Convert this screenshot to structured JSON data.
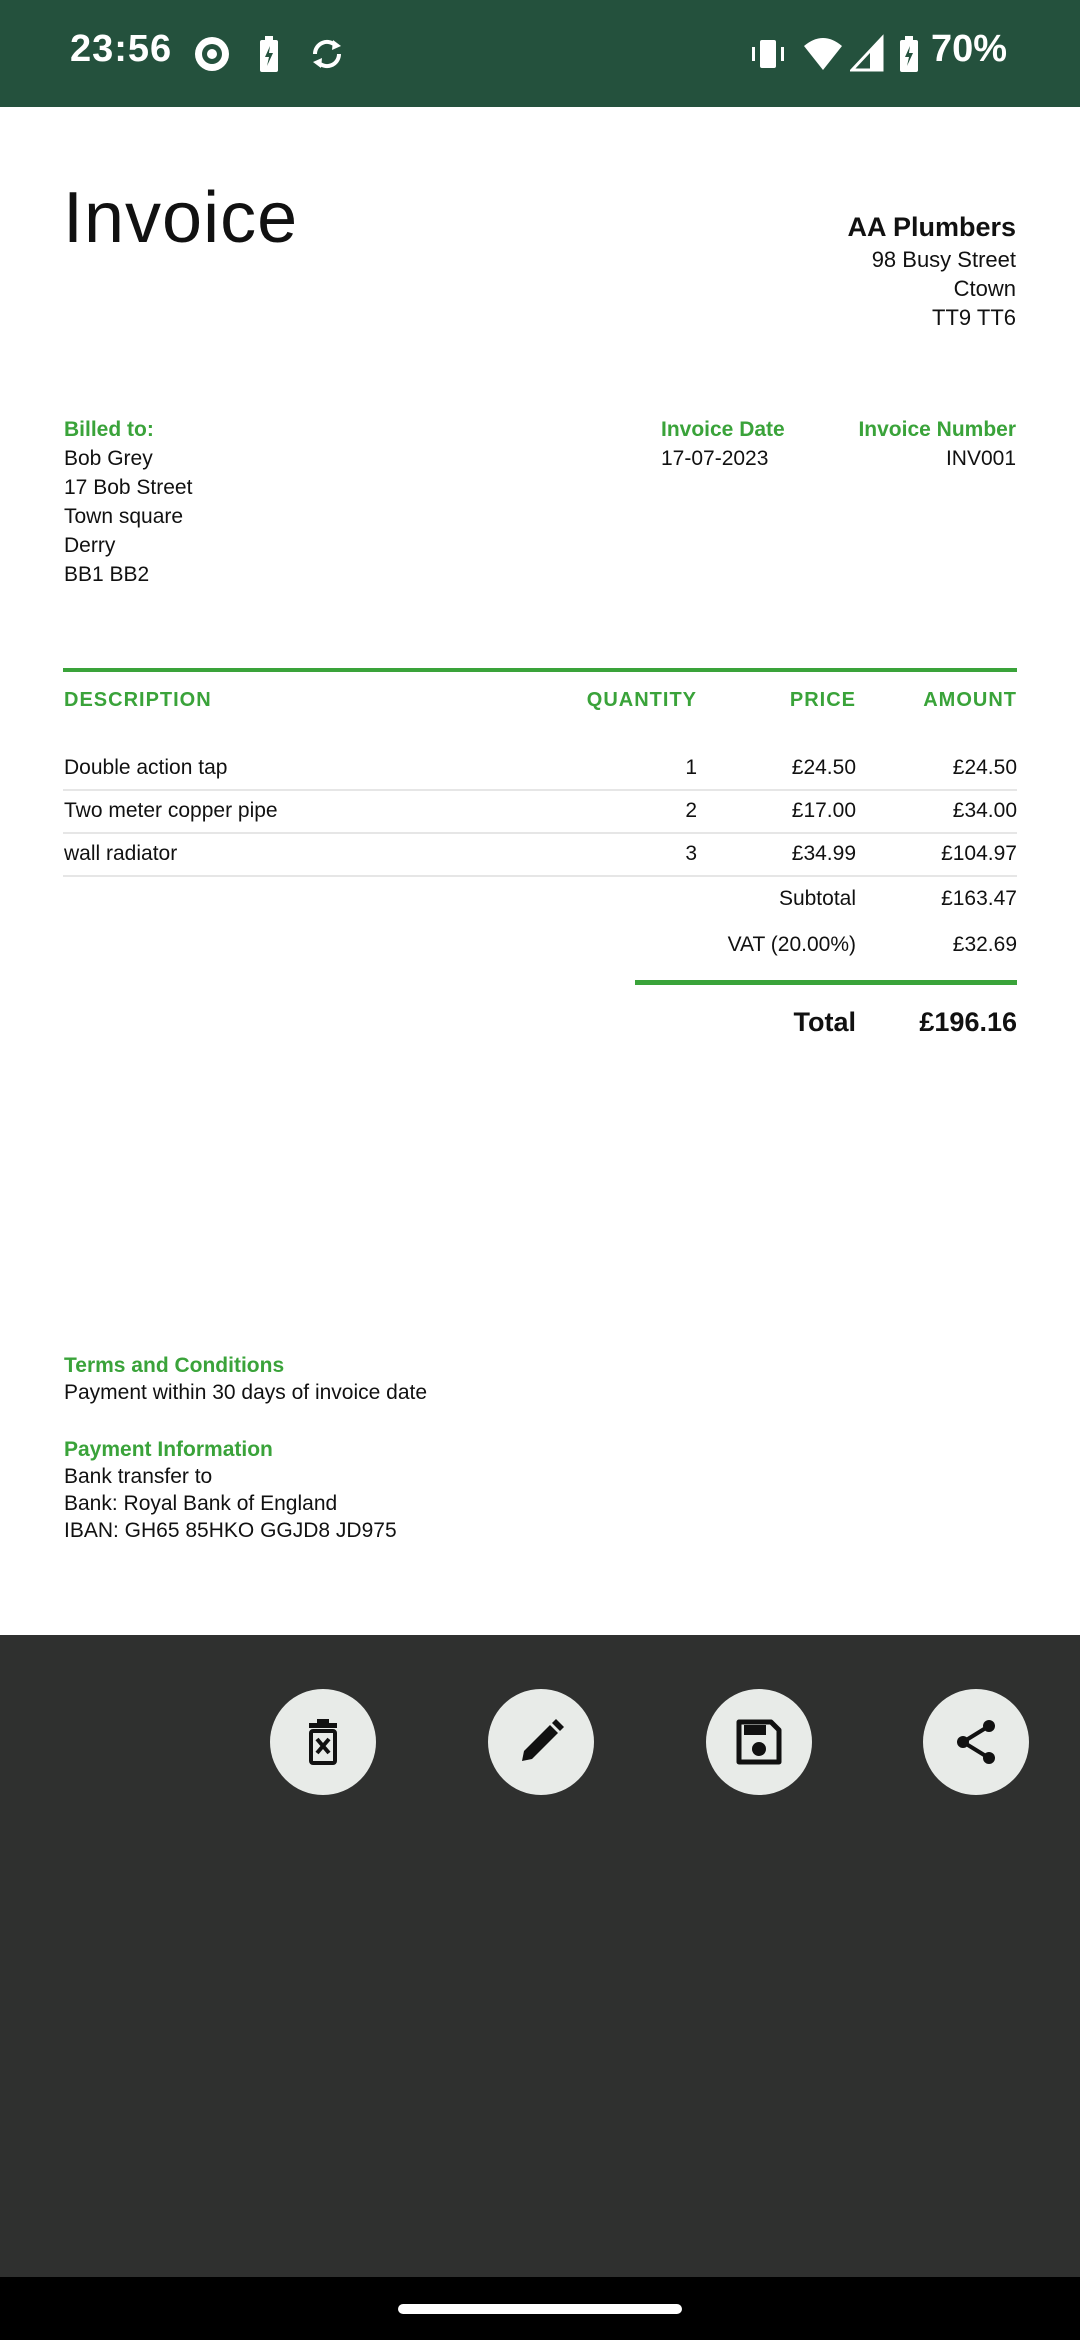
{
  "status_bar": {
    "time": "23:56",
    "battery": "70%"
  },
  "invoice": {
    "title": "Invoice",
    "company": {
      "name": "AA Plumbers",
      "street": "98 Busy Street",
      "town": "Ctown",
      "postcode": "TT9 TT6"
    },
    "billed_to": {
      "label": "Billed to:",
      "name": "Bob Grey",
      "street": "17 Bob Street",
      "area": "Town square",
      "city": "Derry",
      "postcode": "BB1 BB2"
    },
    "invoice_date": {
      "label": "Invoice Date",
      "value": "17-07-2023"
    },
    "invoice_number": {
      "label": "Invoice Number",
      "value": "INV001"
    },
    "table": {
      "headers": {
        "description": "DESCRIPTION",
        "quantity": "QUANTITY",
        "price": "PRICE",
        "amount": "AMOUNT"
      },
      "rows": [
        {
          "description": "Double action tap",
          "quantity": "1",
          "price": "£24.50",
          "amount": "£24.50"
        },
        {
          "description": "Two meter copper pipe",
          "quantity": "2",
          "price": "£17.00",
          "amount": "£34.00"
        },
        {
          "description": "wall radiator",
          "quantity": "3",
          "price": "£34.99",
          "amount": "£104.97"
        }
      ]
    },
    "subtotal": {
      "label": "Subtotal",
      "value": "£163.47"
    },
    "vat": {
      "label": "VAT (20.00%)",
      "value": "£32.69"
    },
    "total": {
      "label": "Total",
      "value": "£196.16"
    },
    "terms": {
      "label": "Terms and Conditions",
      "text": "Payment within 30 days of invoice date"
    },
    "payment": {
      "label": "Payment Information",
      "line1": "Bank transfer to",
      "line2": "Bank: Royal Bank of England",
      "line3": "IBAN: GH65 85HKO GGJD8 JD975"
    }
  },
  "toolbar": {
    "icons": [
      "delete-icon",
      "edit-icon",
      "save-icon",
      "share-icon"
    ]
  },
  "colors": {
    "status_bar": "#24513d",
    "accent": "#3aa33a",
    "bottom_panel": "#2f302f",
    "fab": "#e8ebe8"
  }
}
